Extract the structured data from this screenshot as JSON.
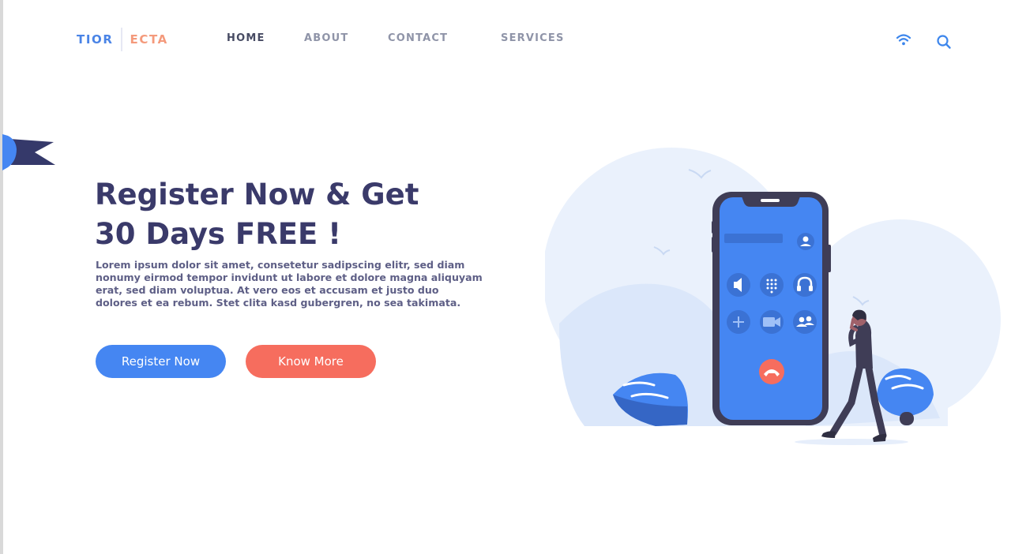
{
  "brand": {
    "left": "TIOR",
    "right": "ECTA",
    "colors": {
      "left": "#4a84e6",
      "right": "#f49a7c"
    }
  },
  "nav": {
    "items": [
      {
        "label": "HOME",
        "active": true
      },
      {
        "label": "ABOUT",
        "active": false
      },
      {
        "label": "CONTACT",
        "active": false
      },
      {
        "label": "SERVICES",
        "active": false
      }
    ]
  },
  "header_icons": {
    "wifi": "wifi-icon",
    "search": "search-icon"
  },
  "hero": {
    "title_line1": "Register Now & Get",
    "title_line2": "30 Days FREE !",
    "body": "Lorem ipsum dolor sit amet, consetetur sadipscing elitr, sed diam nonumy eirmod tempor invidunt ut labore et dolore magna aliquyam erat, sed diam voluptua. At vero eos et accusam et justo duo dolores et ea rebum. Stet clita kasd gubergren, no sea takimata.",
    "buttons": {
      "primary_label": "Register Now",
      "secondary_label": "Know More"
    }
  },
  "phone_icons": [
    "speaker-icon",
    "keypad-icon",
    "headphones-icon",
    "add-icon",
    "video-icon",
    "contacts-icon",
    "hang-up-icon",
    "user-icon"
  ],
  "colors": {
    "title": "#3a3a6a",
    "body_text": "#5e5f86",
    "primary": "#4586f2",
    "secondary": "#f66d5e",
    "phone_screen": "#4586f2",
    "phone_body": "#3f3d56",
    "background_blob": "#eaf1fc",
    "hill": "#dbe7fa",
    "bush": "#3f78d8"
  }
}
